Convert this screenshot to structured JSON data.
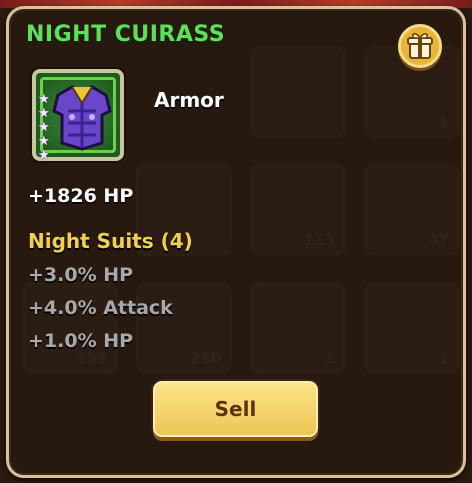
{
  "item": {
    "name": "NIGHT CUIRASS",
    "type": "Armor",
    "stars": 5,
    "icon": "night-cuirass-armor-icon",
    "main_stat": "+1826 HP"
  },
  "set": {
    "name": "Night Suits (4)",
    "bonuses": [
      "+3.0% HP",
      "+4.0% Attack",
      "+1.0% HP"
    ]
  },
  "actions": {
    "sell_label": "Sell",
    "gift_icon": "gift-icon"
  },
  "background_counts": [
    "1",
    "113",
    "47",
    "255",
    "250",
    "1",
    "1"
  ],
  "colors": {
    "title": "#5fe05a",
    "set_name": "#f2d04a",
    "set_bonus": "#a8a8a8",
    "sell_button": "#efc556",
    "panel_border": "#d9c29a"
  }
}
